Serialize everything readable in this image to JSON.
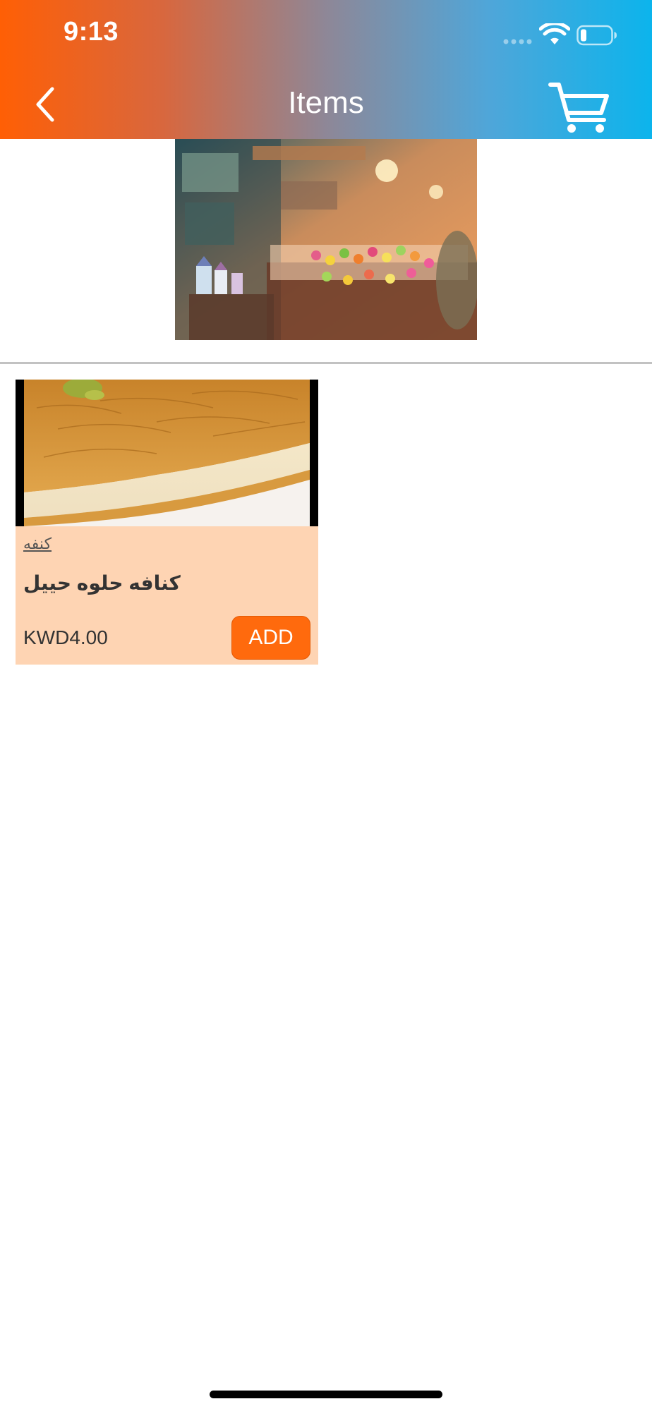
{
  "status_bar": {
    "time": "9:13"
  },
  "nav": {
    "title": "Items",
    "back_icon": "chevron-left-icon",
    "cart_icon": "shopping-cart-icon"
  },
  "banner": {
    "icon": "shop-interior-photo"
  },
  "products": [
    {
      "category": "كنفه",
      "name": "كنافه حلوه حييل",
      "price": "KWD4.00",
      "add_label": "ADD",
      "image": "kunafa-photo"
    }
  ],
  "colors": {
    "header_gradient_start": "#FF5F05",
    "header_gradient_end": "#0CB4EC",
    "card_background": "#FED4B3",
    "add_button": "#FF6A0D"
  }
}
